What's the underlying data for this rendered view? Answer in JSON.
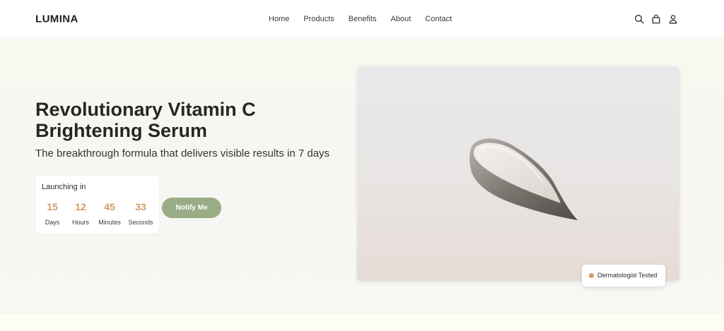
{
  "brand": {
    "logo": "LUMINA"
  },
  "nav": {
    "items": [
      {
        "label": "Home"
      },
      {
        "label": "Products"
      },
      {
        "label": "Benefits"
      },
      {
        "label": "About"
      },
      {
        "label": "Contact"
      }
    ]
  },
  "header_icons": [
    "search-icon",
    "bag-icon",
    "user-icon"
  ],
  "hero": {
    "headline": "Revolutionary Vitamin C Brightening Serum",
    "subheadline": "The breakthrough formula that delivers visible results in 7 days",
    "countdown": {
      "title": "Launching in",
      "units": [
        {
          "value": "15",
          "label": "Days"
        },
        {
          "value": "12",
          "label": "Hours"
        },
        {
          "value": "45",
          "label": "Minutes"
        },
        {
          "value": "33",
          "label": "Seconds"
        }
      ]
    },
    "cta_label": "Notify Me",
    "badge_label": "Dermatologist Tested"
  },
  "colors": {
    "accent": "#d29a64",
    "button": "#9aac86",
    "text": "#262626"
  }
}
